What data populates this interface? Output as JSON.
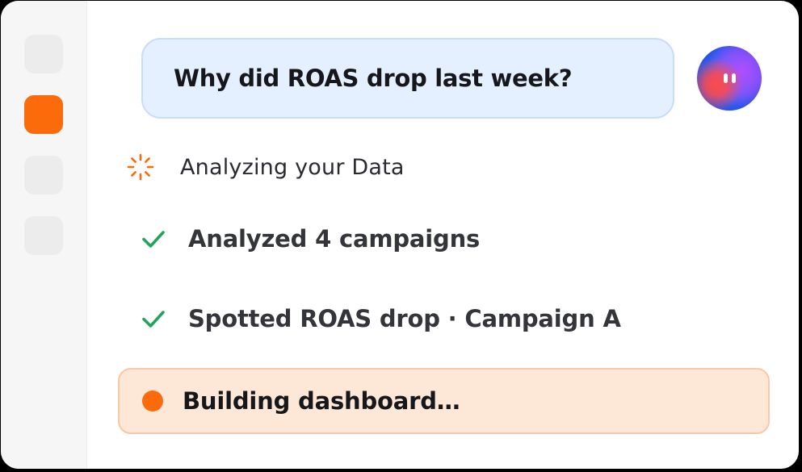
{
  "colors": {
    "accent": "#fb6a0b",
    "success": "#22a55b",
    "question_bg": "#e4efff",
    "active_step_bg": "#fde7d6"
  },
  "sidebar": {
    "items": [
      {
        "icon": "nav-placeholder",
        "active": false
      },
      {
        "icon": "nav-active",
        "active": true
      },
      {
        "icon": "nav-placeholder",
        "active": false
      },
      {
        "icon": "nav-placeholder",
        "active": false
      }
    ]
  },
  "chat": {
    "question": "Why did ROAS drop last week?",
    "avatar_icon": "assistant-avatar"
  },
  "analysis": {
    "status_icon": "spinner-icon",
    "status": "Analyzing your Data",
    "steps": [
      {
        "icon": "check-icon",
        "label": "Analyzed 4 campaigns",
        "state": "done"
      },
      {
        "icon": "check-icon",
        "label": "Spotted ROAS drop · Campaign A",
        "state": "done"
      }
    ],
    "active_step": {
      "icon": "in-progress-dot",
      "label": "Building dashboard…",
      "state": "in-progress"
    }
  }
}
